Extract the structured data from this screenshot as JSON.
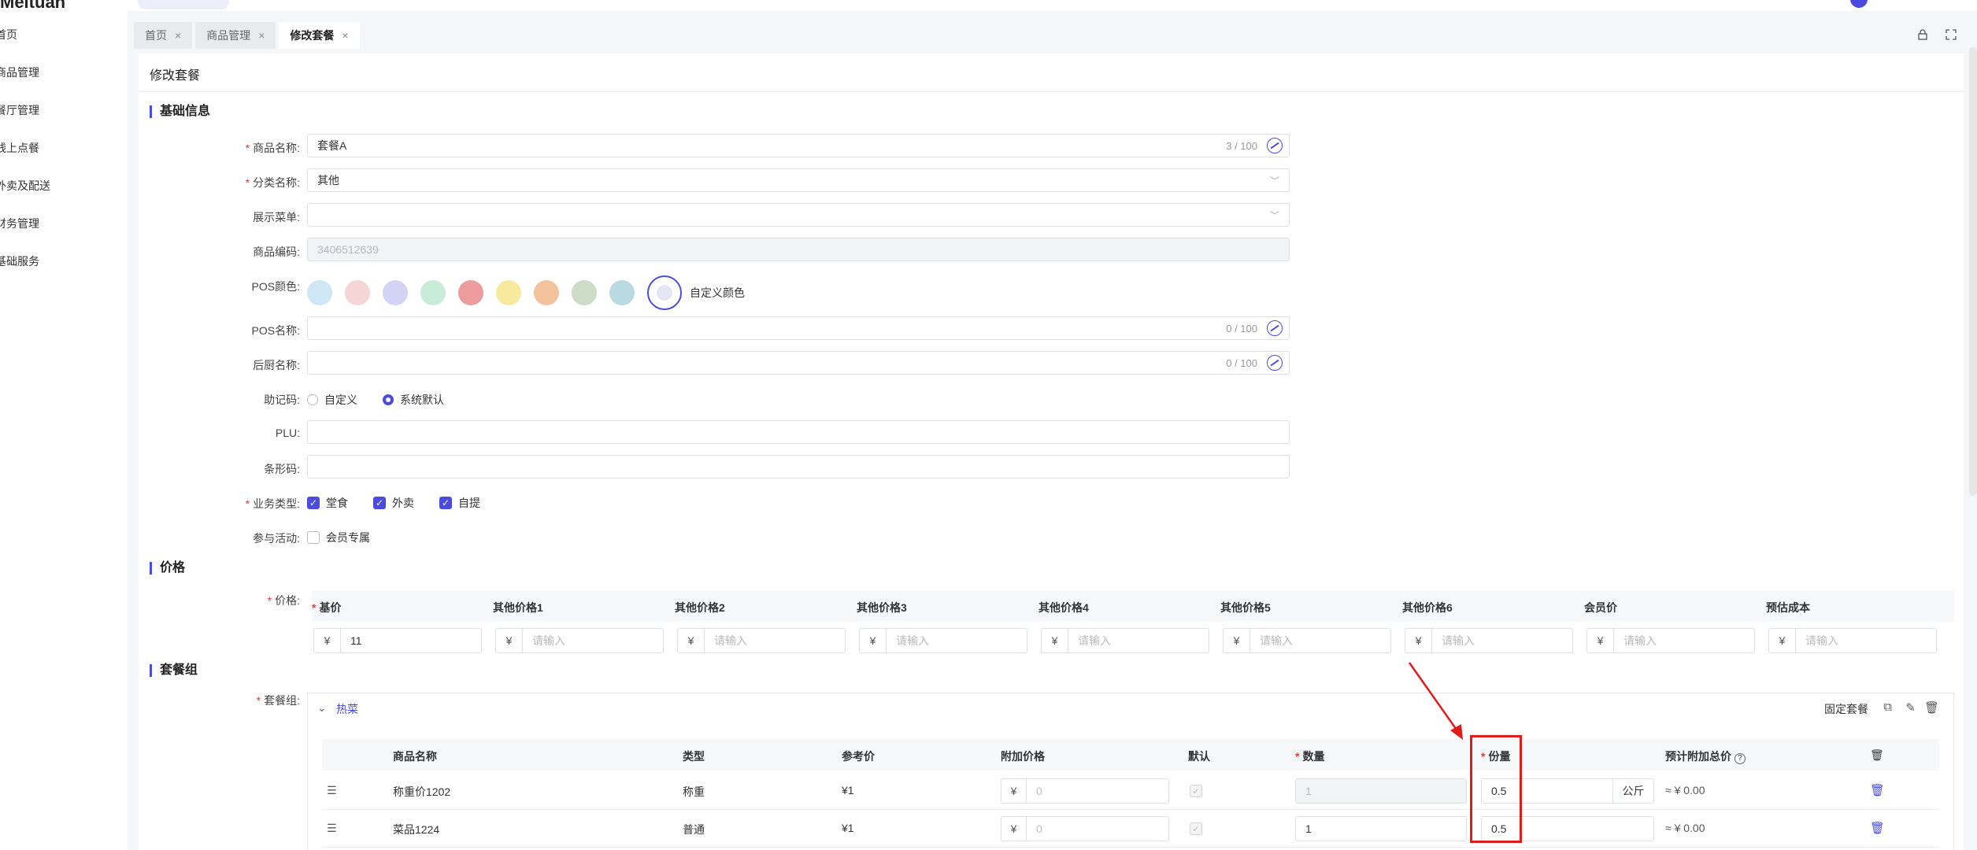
{
  "app": {
    "logo": "Meituan"
  },
  "sidebar": {
    "items": [
      {
        "label": "首页"
      },
      {
        "label": "商品管理"
      },
      {
        "label": "餐厅管理"
      },
      {
        "label": "线上点餐"
      },
      {
        "label": "外卖及配送"
      },
      {
        "label": "财务管理"
      },
      {
        "label": "基础服务"
      }
    ]
  },
  "tabs": [
    {
      "label": "首页",
      "close": "×"
    },
    {
      "label": "商品管理",
      "close": "×"
    },
    {
      "label": "修改套餐",
      "close": "×"
    }
  ],
  "page": {
    "title": "修改套餐"
  },
  "basic": {
    "section": "基础信息",
    "name_label": "商品名称:",
    "name_value": "套餐A",
    "name_counter": "3 / 100",
    "category_label": "分类名称:",
    "category_value": "其他",
    "menu_label": "展示菜单:",
    "menu_value": "",
    "code_label": "商品编码:",
    "code_value": "3406512639",
    "pos_color_label": "POS颜色:",
    "pos_colors": [
      "#cfe6f7",
      "#f5d5d5",
      "#d3d3f5",
      "#c9ecd9",
      "#ec9c9c",
      "#f7ea9e",
      "#f1c29c",
      "#cbdcc7",
      "#b9dae0"
    ],
    "custom_color": "自定义颜色",
    "pos_name_label": "POS名称:",
    "pos_name_counter": "0 / 100",
    "kitchen_label": "后厨名称:",
    "kitchen_counter": "0 / 100",
    "mnemonic_label": "助记码:",
    "mnemonic_opt1": "自定义",
    "mnemonic_opt2": "系统默认",
    "plu_label": "PLU:",
    "barcode_label": "条形码:",
    "biz_label": "业务类型:",
    "biz_opts": [
      "堂食",
      "外卖",
      "自提"
    ],
    "activity_label": "参与活动:",
    "activity_opt": "会员专属"
  },
  "price": {
    "section": "价格",
    "label": "价格:",
    "currency": "¥",
    "columns": [
      {
        "header": "基价",
        "required": true,
        "value": "11",
        "placeholder": ""
      },
      {
        "header": "其他价格1",
        "required": false,
        "value": "",
        "placeholder": "请输入"
      },
      {
        "header": "其他价格2",
        "required": false,
        "value": "",
        "placeholder": "请输入"
      },
      {
        "header": "其他价格3",
        "required": false,
        "value": "",
        "placeholder": "请输入"
      },
      {
        "header": "其他价格4",
        "required": false,
        "value": "",
        "placeholder": "请输入"
      },
      {
        "header": "其他价格5",
        "required": false,
        "value": "",
        "placeholder": "请输入"
      },
      {
        "header": "其他价格6",
        "required": false,
        "value": "",
        "placeholder": "请输入"
      },
      {
        "header": "会员价",
        "required": false,
        "value": "",
        "placeholder": "请输入"
      },
      {
        "header": "预估成本",
        "required": false,
        "value": "",
        "placeholder": "请输入"
      }
    ]
  },
  "combo": {
    "section": "套餐组",
    "label": "套餐组:",
    "group_name": "热菜",
    "fixed_label": "固定套餐",
    "headers": {
      "name": "商品名称",
      "type": "类型",
      "ref_price": "参考价",
      "extra_price": "附加价格",
      "default": "默认",
      "qty": "数量",
      "portion": "份量",
      "total": "预计附加总价"
    },
    "rows": [
      {
        "name": "称重价1202",
        "type": "称重",
        "ref_price": "¥1",
        "extra_price": "0",
        "qty": "1",
        "qty_disabled": true,
        "portion": "0.5",
        "unit": "公斤",
        "total": "≈ ¥ 0.00"
      },
      {
        "name": "菜品1224",
        "type": "普通",
        "ref_price": "¥1",
        "extra_price": "0",
        "qty": "1",
        "qty_disabled": false,
        "portion": "0.5",
        "unit": "",
        "total": "≈ ¥ 0.00"
      }
    ]
  },
  "colors": {
    "accent": "#4b4bde",
    "annotation": "#e01b1b",
    "required": "#e23c3c"
  }
}
